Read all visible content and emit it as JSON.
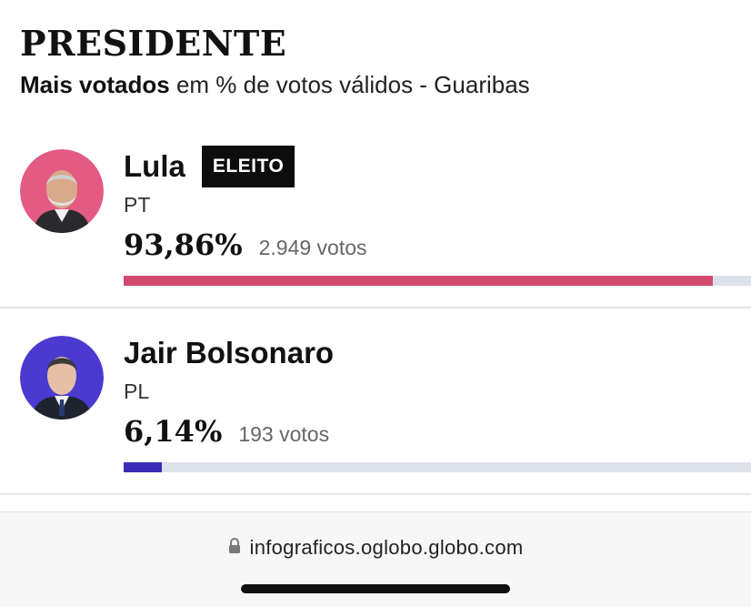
{
  "header": {
    "title": "PRESIDENTE",
    "subtitle_strong": "Mais votados",
    "subtitle_rest": " em % de votos válidos - Guaribas"
  },
  "candidates": [
    {
      "name": "Lula",
      "badge": "ELEITO",
      "party": "PT",
      "percent_text": "93,86%",
      "votes_text": "2.949 votos",
      "percent": 93.86,
      "color": "#d2496f",
      "avatar_bg": "#e35a82"
    },
    {
      "name": "Jair Bolsonaro",
      "party": "PL",
      "percent_text": "6,14%",
      "votes_text": "193 votos",
      "percent": 6.14,
      "color": "#3b2db8",
      "avatar_bg": "#4a3ad0"
    }
  ],
  "footer": {
    "url": "infograficos.oglobo.globo.com",
    "lock_icon": "lock-icon"
  },
  "colors": {
    "track": "#dde2ea",
    "divider": "#e6e6e6"
  }
}
